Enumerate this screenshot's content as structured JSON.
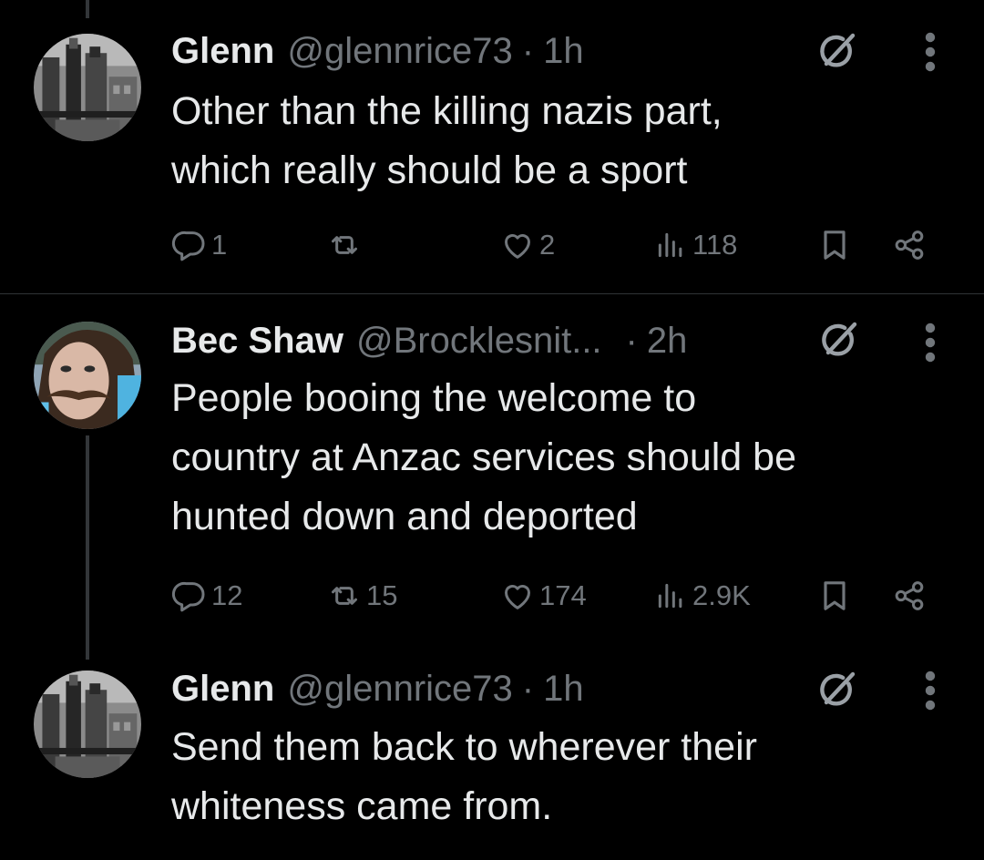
{
  "colors": {
    "background": "#000000",
    "text": "#e7e9ea",
    "muted": "#71767b",
    "divider": "#2f3336",
    "thread_line": "#333639"
  },
  "icons": {
    "reply": "reply-icon",
    "repost": "repost-icon",
    "like": "heart-icon",
    "views": "views-icon",
    "bookmark": "bookmark-icon",
    "share": "share-icon",
    "grok": "grok-icon",
    "more": "more-icon"
  },
  "tweets": [
    {
      "name": "Glenn",
      "handle": "@glennrice73",
      "separator": "·",
      "time": "1h",
      "text_lines": [
        "Other than the killing nazis part,",
        "which really should be a sport"
      ],
      "stats": {
        "replies": "1",
        "reposts": "",
        "likes": "2",
        "views": "118"
      }
    },
    {
      "name": "Bec Shaw",
      "handle": "@Brocklesnit...",
      "separator": "·",
      "time": "2h",
      "text_lines": [
        "People booing the welcome to",
        "country at Anzac services should be",
        "hunted down and deported"
      ],
      "stats": {
        "replies": "12",
        "reposts": "15",
        "likes": "174",
        "views": "2.9K"
      }
    },
    {
      "name": "Glenn",
      "handle": "@glennrice73",
      "separator": "·",
      "time": "1h",
      "text_lines": [
        "Send them back to wherever their",
        "whiteness came from."
      ],
      "stats": {}
    }
  ]
}
